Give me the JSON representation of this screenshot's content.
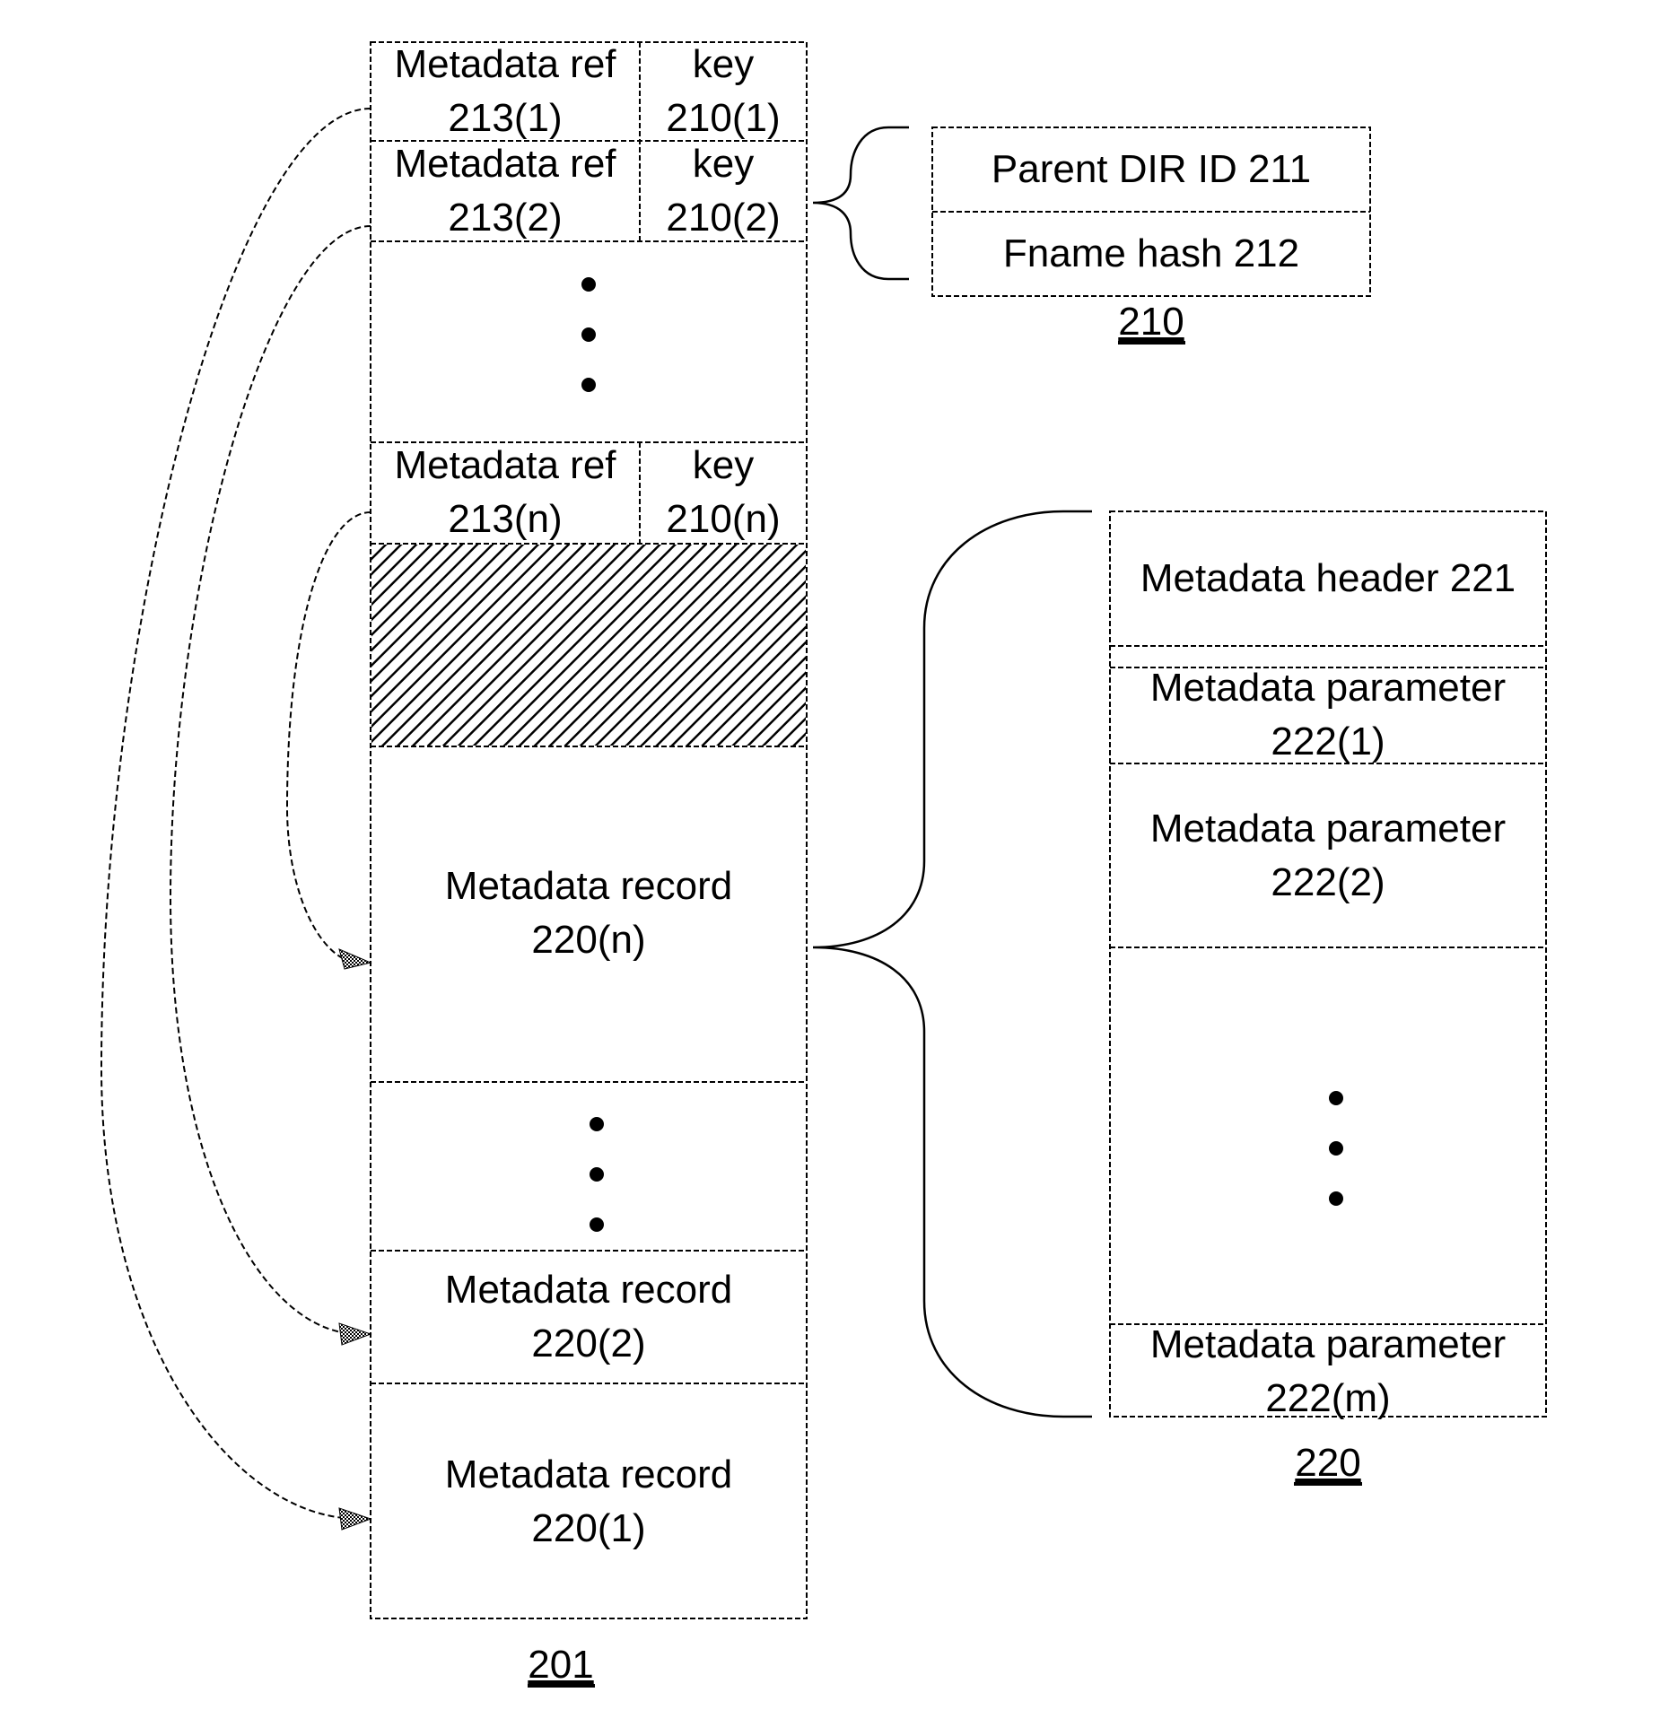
{
  "figure": {
    "structure_201": {
      "label": "201",
      "entries": [
        {
          "ref_line1": "Metadata ref",
          "ref_line2": "213(1)",
          "key_line1": "key",
          "key_line2": "210(1)"
        },
        {
          "ref_line1": "Metadata ref",
          "ref_line2": "213(2)",
          "key_line1": "key",
          "key_line2": "210(2)"
        },
        {
          "ref_line1": "Metadata ref",
          "ref_line2": "213(n)",
          "key_line1": "key",
          "key_line2": "210(n)"
        }
      ],
      "records": [
        {
          "line1": "Metadata record",
          "line2": "220(n)"
        },
        {
          "line1": "Metadata record",
          "line2": "220(2)"
        },
        {
          "line1": "Metadata record",
          "line2": "220(1)"
        }
      ]
    },
    "key_210": {
      "label": "210",
      "fields": [
        "Parent DIR ID 211",
        "Fname hash 212"
      ]
    },
    "record_220": {
      "label": "220",
      "header": "Metadata header 221",
      "parameters": [
        {
          "line1": "Metadata parameter",
          "line2": "222(1)"
        },
        {
          "line1": "Metadata parameter",
          "line2": "222(2)"
        },
        {
          "line1": "Metadata parameter",
          "line2": "222(m)"
        }
      ]
    }
  }
}
